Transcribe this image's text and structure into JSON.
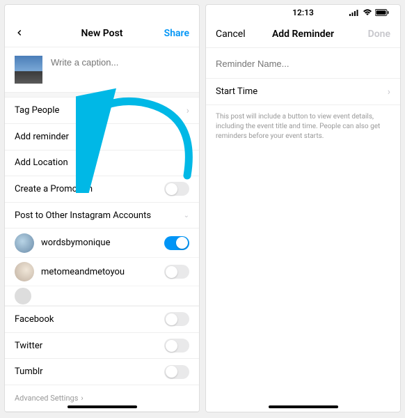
{
  "left": {
    "nav": {
      "title": "New Post",
      "share": "Share"
    },
    "caption_placeholder": "Write a caption...",
    "rows": {
      "tag_people": "Tag People",
      "add_reminder": "Add reminder",
      "add_location": "Add Location",
      "create_promotion": "Create a Promotion",
      "post_other": "Post to Other Instagram Accounts"
    },
    "accounts": [
      {
        "name": "wordsbymonique",
        "on": true
      },
      {
        "name": "metomeandmetoyou",
        "on": false
      }
    ],
    "share_to": {
      "facebook": "Facebook",
      "twitter": "Twitter",
      "tumblr": "Tumblr"
    },
    "advanced": "Advanced Settings"
  },
  "right": {
    "status_time": "12:13",
    "nav": {
      "cancel": "Cancel",
      "title": "Add Reminder",
      "done": "Done"
    },
    "reminder_placeholder": "Reminder Name...",
    "start_time": "Start Time",
    "description": "This post will include a button to view event details, including the event title and time. People can also get reminders before your event starts."
  },
  "arrow_color": "#00b8e6"
}
